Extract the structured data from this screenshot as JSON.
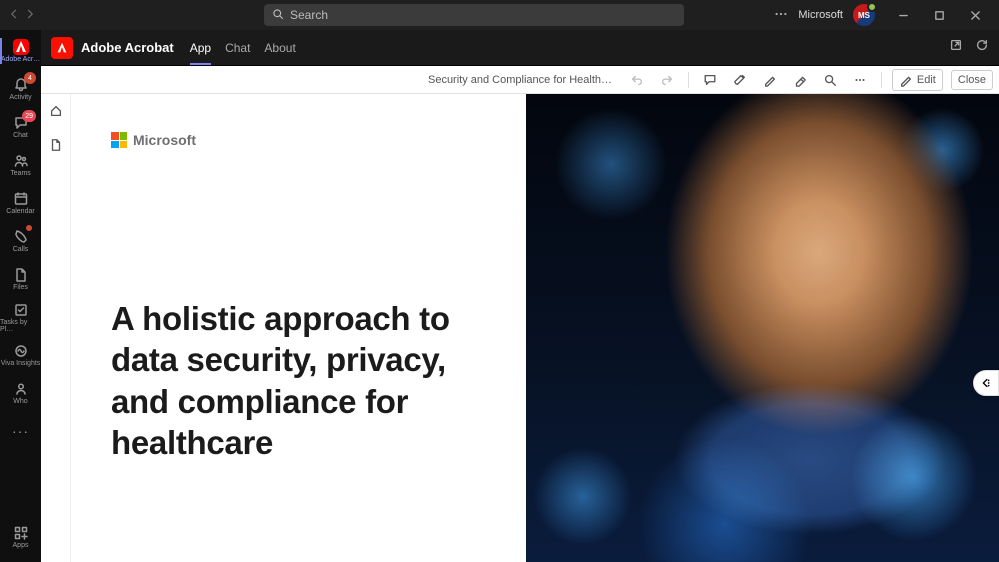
{
  "titlebar": {
    "search_placeholder": "Search",
    "org_label": "Microsoft",
    "avatar_initials": "MS"
  },
  "rail": {
    "items": [
      {
        "id": "adobe",
        "label": "Adobe Acr…",
        "active": true
      },
      {
        "id": "activity",
        "label": "Activity",
        "badge": "4",
        "badge_style": "red"
      },
      {
        "id": "chat",
        "label": "Chat",
        "badge": "29",
        "badge_style": "pink"
      },
      {
        "id": "teams",
        "label": "Teams"
      },
      {
        "id": "calendar",
        "label": "Calendar"
      },
      {
        "id": "calls",
        "label": "Calls",
        "dot": true
      },
      {
        "id": "files",
        "label": "Files"
      },
      {
        "id": "tasks",
        "label": "Tasks by Pl…"
      },
      {
        "id": "viva",
        "label": "Viva Insights"
      },
      {
        "id": "who",
        "label": "Who"
      }
    ],
    "apps_label": "Apps"
  },
  "app_header": {
    "brand": "Adobe Acrobat",
    "tabs": [
      {
        "id": "app",
        "label": "App",
        "active": true
      },
      {
        "id": "chat",
        "label": "Chat"
      },
      {
        "id": "about",
        "label": "About"
      }
    ]
  },
  "docbar": {
    "title": "Security and Compliance for Health…",
    "edit_label": "Edit",
    "close_label": "Close"
  },
  "document": {
    "brand_word": "Microsoft",
    "heading": "A holistic approach to data security, privacy, and compliance for healthcare"
  }
}
